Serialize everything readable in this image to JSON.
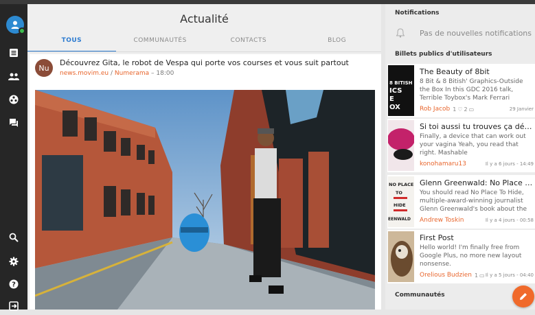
{
  "page": {
    "title": "Actualité"
  },
  "tabs": [
    {
      "label": "TOUS"
    },
    {
      "label": "COMMUNAUTÉS"
    },
    {
      "label": "CONTACTS"
    },
    {
      "label": "BLOG"
    }
  ],
  "post": {
    "avatar_initials": "Nu",
    "title": "Découvrez Gita, le robot de Vespa qui porte vos courses et vous suit partout",
    "source": "news.movim.eu",
    "separator": " / ",
    "origin": "Numerama",
    "dash": " – ",
    "time": "18:00"
  },
  "notifications": {
    "heading": "Notifications",
    "empty_text": "Pas de nouvelles notifications",
    "icon": "bell-icon"
  },
  "public_posts": {
    "heading": "Billets publics d'utilisateurs",
    "items": [
      {
        "title": "The Beauty of 8bit",
        "excerpt": "8 Bit & 8 Bitish' Graphics-Outside the Box In this GDC 2016 talk, Terrible Toybox's Mark Ferrari discusses and",
        "author": "Rob Jacob",
        "likes": "1",
        "comments": "2",
        "time": "29 Janvier",
        "thumb_label": "8 BITISH\nICS\nE\nOX"
      },
      {
        "title": "Si toi aussi tu trouves ça dérang…",
        "excerpt": "Finally, a device that can work out your vagina Yeah, you read that right. Mashable",
        "author": "konohamaru13",
        "time": "Il y a 6 jours - 14:49"
      },
      {
        "title": "Glenn Greenwald: No Place To …",
        "excerpt": "You should read No Place To Hide, multiple-award-winning journalist Glenn Greenwald's book about the",
        "author": "Andrew Toskin",
        "time": "Il y a 4 jours - 00:58",
        "thumb_label": "NO PLACE\nTO\nHIDE\nEENWALD"
      },
      {
        "title": "First Post",
        "excerpt": "Hello world! I'm finally free from Google Plus, no more new layout nonsense.",
        "author": "Orelious Budzien",
        "likes": "1",
        "time": "Il y a 5 jours - 04:40"
      }
    ]
  },
  "communities": {
    "heading": "Communautés"
  },
  "sidebar": {
    "items": [
      "news-icon",
      "contacts-icon",
      "communities-icon",
      "chat-icon",
      "search-icon",
      "settings-icon",
      "help-icon",
      "logout-icon"
    ]
  },
  "colors": {
    "accent": "#2c7bd0",
    "brand": "#e8652c",
    "sidebar": "#262626"
  }
}
